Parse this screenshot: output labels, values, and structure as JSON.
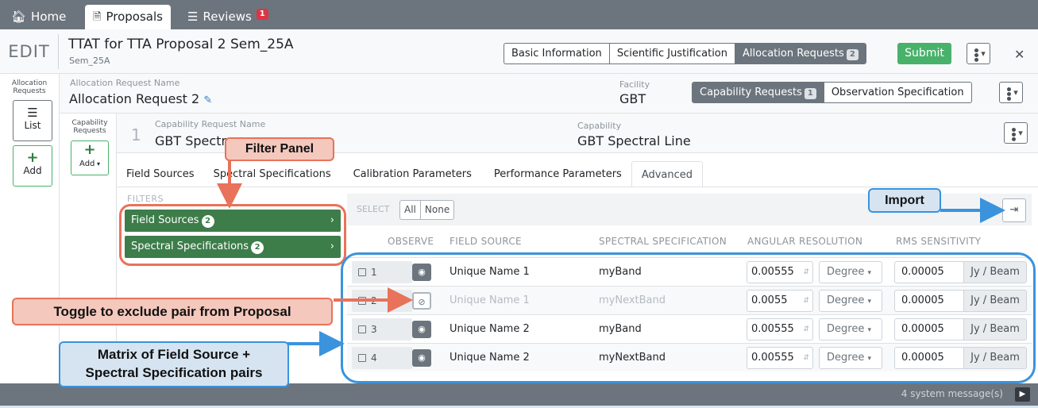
{
  "nav": {
    "home": "Home",
    "proposals": "Proposals",
    "reviews": "Reviews",
    "reviews_badge": "1"
  },
  "header": {
    "mode": "EDIT",
    "title": "TTAT for TTA Proposal 2 Sem_25A",
    "subtitle": "Sem_25A",
    "tabs": {
      "basic": "Basic Information",
      "science": "Scientific Justification",
      "alloc": "Allocation Requests",
      "alloc_count": "2"
    },
    "submit": "Submit"
  },
  "alloc_side": {
    "label": "Allocation Requests",
    "list": "List",
    "add": "Add"
  },
  "alloc_request": {
    "name_label": "Allocation Request Name",
    "name": "Allocation Request 2",
    "facility_label": "Facility",
    "facility": "GBT",
    "capability_tab": "Capability Requests",
    "capability_count": "1",
    "observation_tab": "Observation Specification"
  },
  "cap_side": {
    "label": "Capability Requests",
    "add": "Add"
  },
  "capability": {
    "number": "1",
    "name_label": "Capability Request Name",
    "name": "GBT Spectr",
    "cap_label": "Capability",
    "cap": "GBT Spectral Line"
  },
  "tabs": [
    "Field Sources",
    "Spectral Specifications",
    "Calibration Parameters",
    "Performance Parameters",
    "Advanced"
  ],
  "filters": {
    "label": "FILTERS",
    "items": [
      {
        "label": "Field Sources",
        "count": "2"
      },
      {
        "label": "Spectral Specifications",
        "count": "2"
      }
    ]
  },
  "select": {
    "label": "SELECT",
    "all": "All",
    "none": "None"
  },
  "columns": {
    "observe": "OBSERVE",
    "field_source": "FIELD SOURCE",
    "spectral": "SPECTRAL SPECIFICATION",
    "angular": "ANGULAR RESOLUTION",
    "rms": "RMS SENSITIVITY"
  },
  "rows": [
    {
      "idx": "1",
      "source": "Unique Name 1",
      "spec": "myBand",
      "ang": "0.00555",
      "ang_unit": "Degree",
      "rms": "0.00005",
      "rms_unit": "Jy / Beam",
      "observe": true
    },
    {
      "idx": "2",
      "source": "Unique Name 1",
      "spec": "myNextBand",
      "ang": "0.0055",
      "ang_unit": "Degree",
      "rms": "0.00005",
      "rms_unit": "Jy / Beam",
      "observe": false
    },
    {
      "idx": "3",
      "source": "Unique Name 2",
      "spec": "myBand",
      "ang": "0.00555",
      "ang_unit": "Degree",
      "rms": "0.00005",
      "rms_unit": "Jy / Beam",
      "observe": true
    },
    {
      "idx": "4",
      "source": "Unique Name 2",
      "spec": "myNextBand",
      "ang": "0.00555",
      "ang_unit": "Degree",
      "rms": "0.00005",
      "rms_unit": "Jy / Beam",
      "observe": true
    }
  ],
  "footer": {
    "messages": "4 system message(s)"
  },
  "annotations": {
    "filter_panel": "Filter Panel",
    "import": "Import",
    "toggle": "Toggle to exclude pair from Proposal",
    "matrix_line1": "Matrix of Field Source +",
    "matrix_line2": "Spectral Specification pairs"
  },
  "colors": {
    "annotation_orange": "#e8725a",
    "annotation_blue": "#3a93dc",
    "filter_green": "#3d7d4a",
    "submit_green": "#48b26a"
  }
}
